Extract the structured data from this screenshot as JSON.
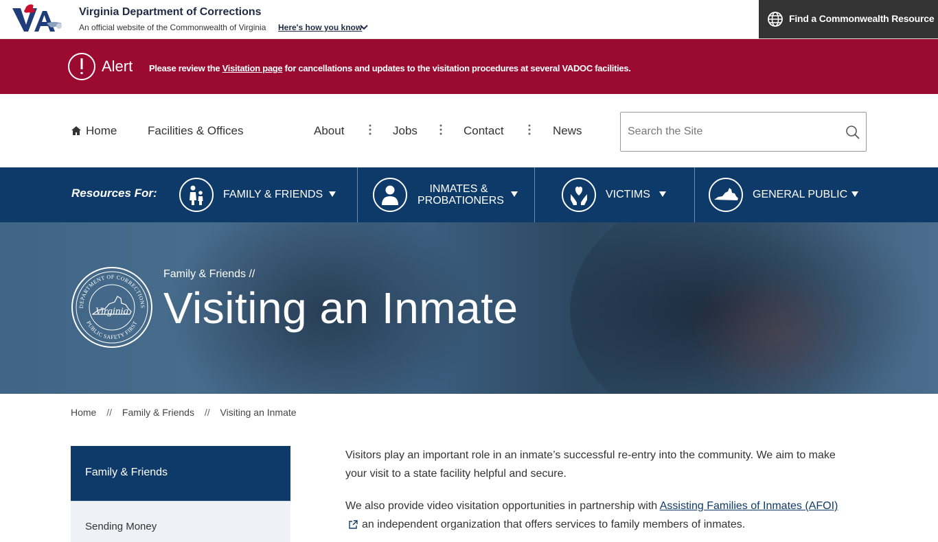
{
  "topbar": {
    "site_name": "Virginia Department of Corrections",
    "official_text": "An official website of the Commonwealth of Virginia",
    "how_you_know": "Here's how you know",
    "find_resource": "Find a Commonwealth Resource"
  },
  "alert": {
    "title": "Alert",
    "msg_prefix": "Please review the",
    "msg_link": "Visitation page",
    "msg_suffix": "for cancellations and updates to the visitation procedures at several VADOC facilities.",
    "color": "#9b0a31"
  },
  "nav": {
    "home": "Home",
    "facilities": "Facilities & Offices",
    "about": "About",
    "jobs": "Jobs",
    "contact": "Contact",
    "news": "News",
    "search_placeholder": "Search the Site"
  },
  "resources": {
    "label": "Resources For:",
    "items": [
      {
        "label": "Family & Friends",
        "icon": "family-icon"
      },
      {
        "label_line1": "Inmates &",
        "label_line2": "Probationers",
        "icon": "person-icon"
      },
      {
        "label": "Victims",
        "icon": "heart-hands-icon"
      },
      {
        "label": "General Public",
        "icon": "virginia-map-icon"
      }
    ],
    "color": "#0e3a6a"
  },
  "hero": {
    "crumb": "Family & Friends  //",
    "title": "Visiting an Inmate",
    "seal_top": "DEPARTMENT OF CORRECTIONS",
    "seal_bottom": "PUBLIC SAFETY FIRST",
    "seal_center": "Virginia"
  },
  "breadcrumb": {
    "home": "Home",
    "sep": "//",
    "section": "Family & Friends",
    "current": "Visiting an Inmate"
  },
  "sidenav": {
    "heading": "Family & Friends",
    "items": [
      "Sending Money"
    ]
  },
  "content": {
    "p1": "Visitors play an important role in an inmate’s successful re-entry into the community. We aim to make your visit to a state facility helpful and secure.",
    "p2_prefix": "We also provide video visitation opportunities in partnership with",
    "p2_link": "Assisting Families of Inmates (AFOI)",
    "p2_suffix": "an independent organization that offers services to family members of inmates."
  }
}
